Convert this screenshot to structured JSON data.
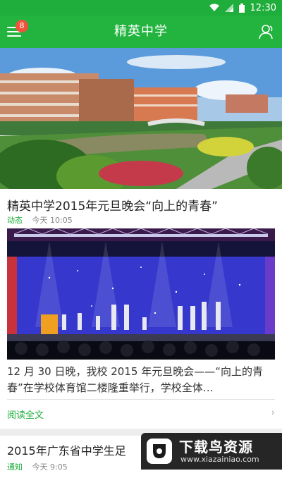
{
  "status_bar": {
    "time": "12:30"
  },
  "app_bar": {
    "title": "精英中学",
    "notification_count": "8"
  },
  "feed": [
    {
      "headline": "精英中学2015年元旦晚会“向上的青春”",
      "tag": "动态",
      "time": "今天 10:05",
      "excerpt": "12 月 30 日晚，我校 2015 年元旦晚会——“向上的青春”在学校体育馆二楼隆重举行，学校全体…",
      "read_more": "阅读全文",
      "chevron": "›"
    },
    {
      "headline": "2015年广东省中学生足",
      "tag": "通知",
      "time": "今天 9:05"
    }
  ],
  "watermark": {
    "title": "下载鸟资源",
    "url": "www.xiazainiao.com"
  },
  "colors": {
    "primary": "#22b43f",
    "badge": "#f0523e"
  }
}
